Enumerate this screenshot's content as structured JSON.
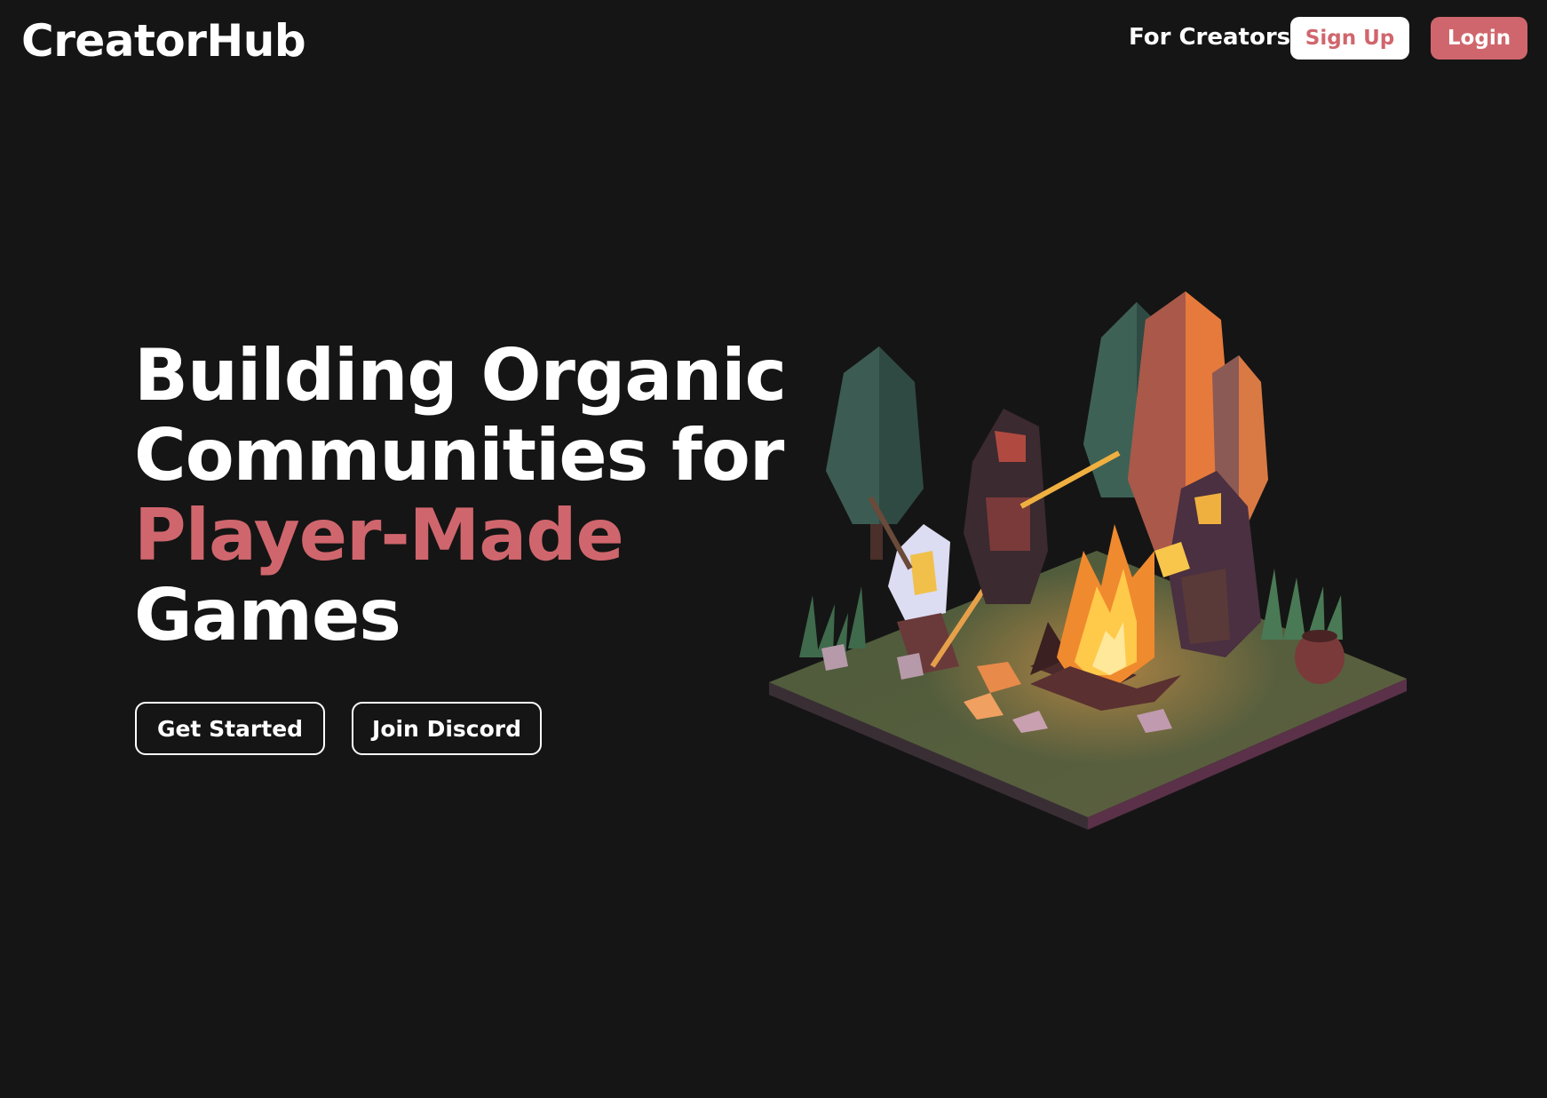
{
  "header": {
    "logo": "CreatorHub",
    "nav_link": "For Creators",
    "signup_label": "Sign Up",
    "login_label": "Login"
  },
  "hero": {
    "title_line1": "Building Organic",
    "title_line2": "Communities for",
    "title_accent": "Player-Made",
    "title_line4": "Games",
    "cta_primary": "Get Started",
    "cta_secondary": "Join Discord"
  },
  "colors": {
    "background": "#151515",
    "accent": "#d0666d",
    "text": "#ffffff"
  },
  "illustration": {
    "subject": "campfire-scene-icon"
  }
}
